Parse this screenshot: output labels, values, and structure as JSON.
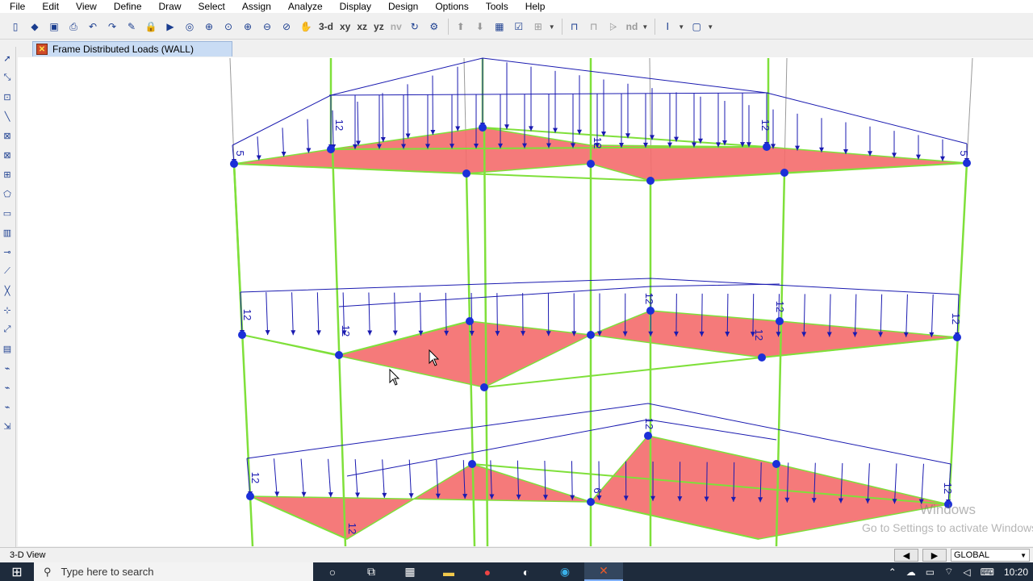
{
  "menu": [
    "File",
    "Edit",
    "View",
    "Define",
    "Draw",
    "Select",
    "Assign",
    "Analyze",
    "Display",
    "Design",
    "Options",
    "Tools",
    "Help"
  ],
  "toolbar": {
    "view_3d": "3-d",
    "view_xy": "xy",
    "view_xz": "xz",
    "view_yz": "yz",
    "view_nv": "nv",
    "nd_label": "nd"
  },
  "tab": {
    "title": "Frame Distributed Loads (WALL)"
  },
  "status": {
    "view_name": "3-D View",
    "coord_system": "GLOBAL"
  },
  "watermark": {
    "line1": "Windows",
    "line2": "Go to Settings to activate Windows."
  },
  "taskbar": {
    "search_placeholder": "Type here to search",
    "clock": "10:20"
  },
  "model": {
    "load_labels": [
      "12",
      "12",
      "5",
      "5",
      "12",
      "12",
      "12",
      "12",
      "12",
      "12",
      "12",
      "12",
      "6",
      "12",
      "12",
      "12"
    ],
    "colors": {
      "column": "#7fe03a",
      "load_line": "#1a1ab0",
      "slab": "#f46b6b",
      "joint": "#1b2fd8"
    }
  }
}
